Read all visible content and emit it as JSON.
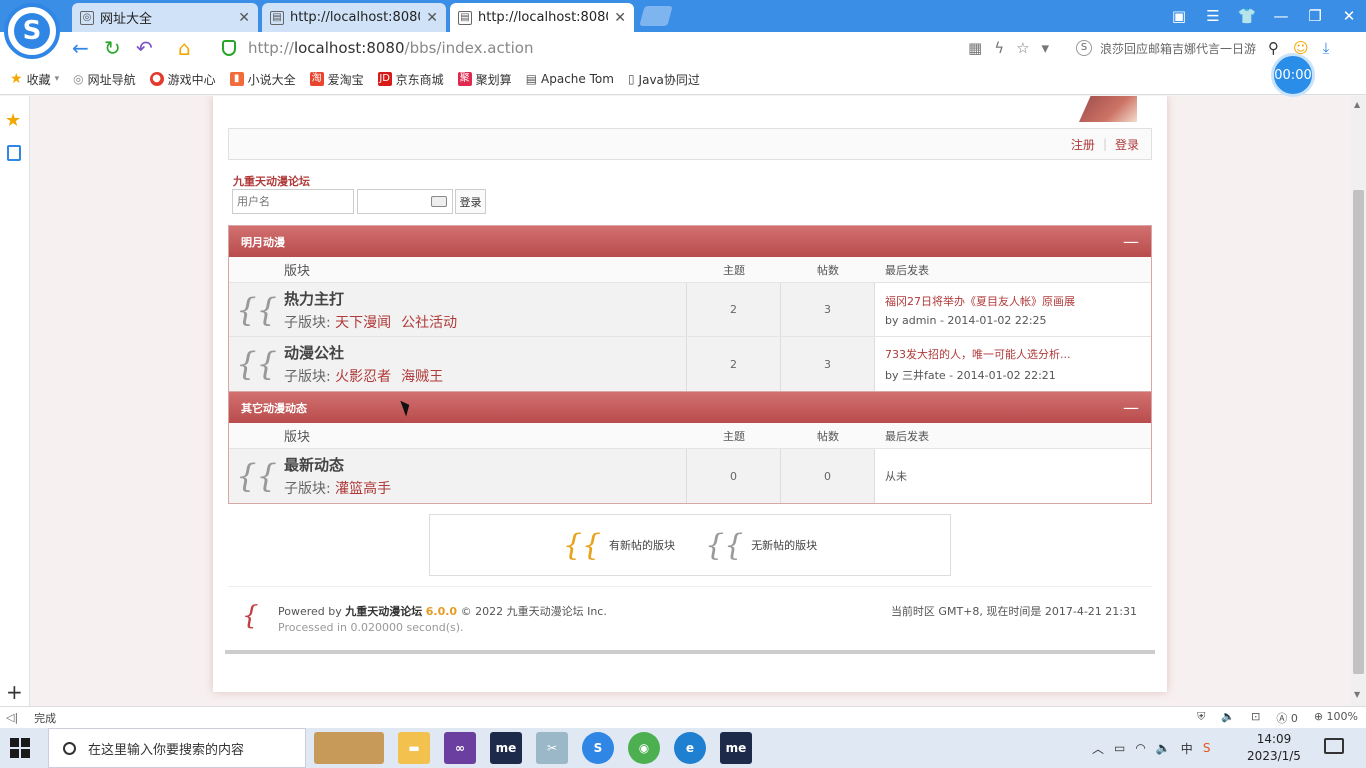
{
  "browser": {
    "tabs": [
      {
        "title": "网址大全",
        "icon": "globe-icon",
        "active": false
      },
      {
        "title": "http://localhost:8080/l",
        "icon": "page-icon",
        "active": false
      },
      {
        "title": "http://localhost:8080/l",
        "icon": "page-icon",
        "active": true
      }
    ],
    "url_prefix": "http://",
    "url_host": "localhost:8080",
    "url_path": "/bbs/index.action",
    "search_hint": "浪莎回应邮箱吉娜代言一日游",
    "timer": "00:00",
    "bookmarks": [
      {
        "label": "收藏",
        "icon": "star-icon",
        "color": "#f2a800"
      },
      {
        "label": "网址导航",
        "icon": "globe-icon",
        "color": "#888888"
      },
      {
        "label": "游戏中心",
        "icon": "game-icon",
        "color": "#e33b2e"
      },
      {
        "label": "小说大全",
        "icon": "book-icon",
        "color": "#f26b3a"
      },
      {
        "label": "爱淘宝",
        "icon": "taobao-icon",
        "color": "#e8442e"
      },
      {
        "label": "京东商城",
        "icon": "jd-icon",
        "color": "#d71c1c"
      },
      {
        "label": "聚划算",
        "icon": "juhuasuan-icon",
        "color": "#e0294e"
      },
      {
        "label": "Apache Tom",
        "icon": "page-icon",
        "color": "#666666"
      },
      {
        "label": "Java协同过",
        "icon": "doc-icon",
        "color": "#666666"
      }
    ]
  },
  "forum": {
    "top_links": {
      "register": "注册",
      "login": "登录"
    },
    "site_name": "九重天动漫论坛",
    "login_form": {
      "username_placeholder": "用户名",
      "button": "登录"
    },
    "columns": {
      "forum": "版块",
      "topics": "主题",
      "posts": "帖数",
      "last": "最后发表"
    },
    "sections": [
      {
        "title": "明月动漫",
        "forums": [
          {
            "name": "热力主打",
            "sub_label": "子版块:",
            "subs": [
              "天下漫闻",
              "公社活动"
            ],
            "topics": "2",
            "posts": "3",
            "last_title": "福冈27日将举办《夏目友人帐》原画展",
            "last_by": "by admin - 2014-01-02 22:25"
          },
          {
            "name": "动漫公社",
            "sub_label": "子版块:",
            "subs": [
              "火影忍者",
              "海贼王"
            ],
            "topics": "2",
            "posts": "3",
            "last_title": "733发大招的人，唯一可能人选分析...",
            "last_by": "by 三井fate - 2014-01-02 22:21"
          }
        ]
      },
      {
        "title": "其它动漫动态",
        "forums": [
          {
            "name": "最新动态",
            "sub_label": "子版块:",
            "subs": [
              "灌篮高手"
            ],
            "topics": "0",
            "posts": "0",
            "last_title": "",
            "last_by": "从未"
          }
        ]
      }
    ],
    "legend": {
      "new": "有新帖的版块",
      "none": "无新帖的版块"
    },
    "footer": {
      "powered_prefix": "Powered by",
      "powered_name": "九重天动漫论坛",
      "version": "6.0.0",
      "copyright": "© 2022 九重天动漫论坛 Inc.",
      "processed": "Processed in 0.020000 second(s).",
      "timezone": "当前时区 GMT+8, 现在时间是 2017-4-21 21:31"
    }
  },
  "status": {
    "text": "完成",
    "zoom": "100%",
    "ad_count": "0"
  },
  "taskbar": {
    "search_placeholder": "在这里输入你要搜索的内容",
    "time": "14:09",
    "date": "2023/1/5",
    "ime": "中"
  }
}
